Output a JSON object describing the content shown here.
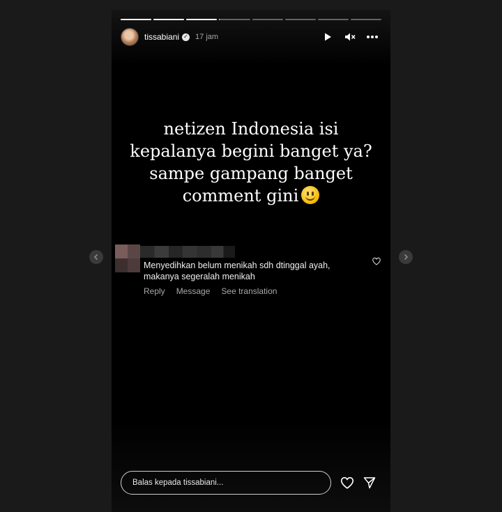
{
  "story": {
    "username": "tissabiani",
    "time": "17 jam",
    "verified": true,
    "progress": {
      "segments": 8,
      "completed": 3,
      "current_fraction": 0.02
    },
    "caption_lines": [
      "netizen Indonesia isi",
      "kepalanya begini banget ya?",
      "sampe gampang banget",
      "comment gini"
    ],
    "caption_emoji": "slightly-smiling-face-icon"
  },
  "comment": {
    "text_lines": [
      "Menyedihkan belum menikah sdh dtinggal ayah,",
      "makanya segeralah menikah"
    ],
    "actions": {
      "reply": "Reply",
      "message": "Message",
      "translate": "See translation"
    }
  },
  "reply_bar": {
    "placeholder": "Balas kepada tissabiani..."
  },
  "colors": {
    "background": "#1a1a1a",
    "story_bg": "#000000",
    "text": "#ffffff",
    "muted": "#a8a8a8"
  }
}
